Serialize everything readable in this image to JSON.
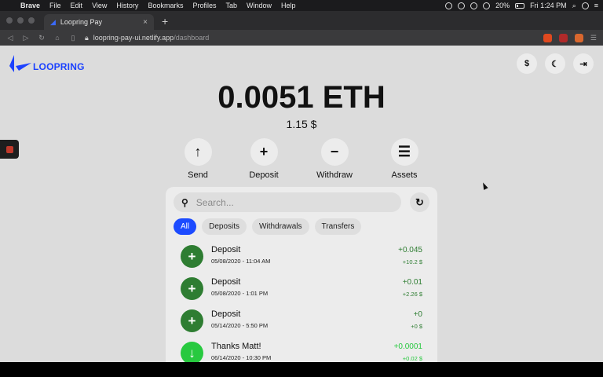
{
  "menubar": {
    "app": "Brave",
    "items": [
      "File",
      "Edit",
      "View",
      "History",
      "Bookmarks",
      "Profiles",
      "Tab",
      "Window",
      "Help"
    ],
    "battery": "20%",
    "clock": "Fri 1:24 PM"
  },
  "browser": {
    "tab_title": "Loopring Pay",
    "url_host": "loopring-pay-ui.netlify.app",
    "url_path": "/dashboard"
  },
  "header": {
    "logo_text": "LOOPRING",
    "currency_button": "$",
    "theme_icon": "moon-icon",
    "logout_icon": "logout-icon"
  },
  "balance": {
    "amount": "0.0051 ETH",
    "fiat": "1.15 $"
  },
  "actions": [
    {
      "label": "Send",
      "icon": "arrow-up-icon",
      "glyph": "↑"
    },
    {
      "label": "Deposit",
      "icon": "plus-icon",
      "glyph": "+"
    },
    {
      "label": "Withdraw",
      "icon": "minus-icon",
      "glyph": "−"
    },
    {
      "label": "Assets",
      "icon": "list-icon",
      "glyph": "☰"
    }
  ],
  "search": {
    "placeholder": "Search..."
  },
  "filters": [
    "All",
    "Deposits",
    "Withdrawals",
    "Transfers"
  ],
  "active_filter": "All",
  "transactions": [
    {
      "name": "Deposit",
      "date": "05/08/2020 - 11:04 AM",
      "amount": "+0.045",
      "fiat": "+10.2 $",
      "icon": "plus-icon",
      "glyph": "+"
    },
    {
      "name": "Deposit",
      "date": "05/08/2020 - 1:01 PM",
      "amount": "+0.01",
      "fiat": "+2.26 $",
      "icon": "plus-icon",
      "glyph": "+"
    },
    {
      "name": "Deposit",
      "date": "05/14/2020 - 5:50 PM",
      "amount": "+0",
      "fiat": "+0 $",
      "icon": "plus-icon",
      "glyph": "+"
    },
    {
      "name": "Thanks Matt!",
      "date": "06/14/2020 - 10:30 PM",
      "amount": "+0.0001",
      "fiat": "+0.02 $",
      "icon": "arrow-down-icon",
      "glyph": "↓"
    }
  ],
  "colors": {
    "accent": "#1c4bff",
    "deposit": "#2e7d32",
    "transfer": "#27c93f",
    "page_bg": "#dcdcdc"
  }
}
